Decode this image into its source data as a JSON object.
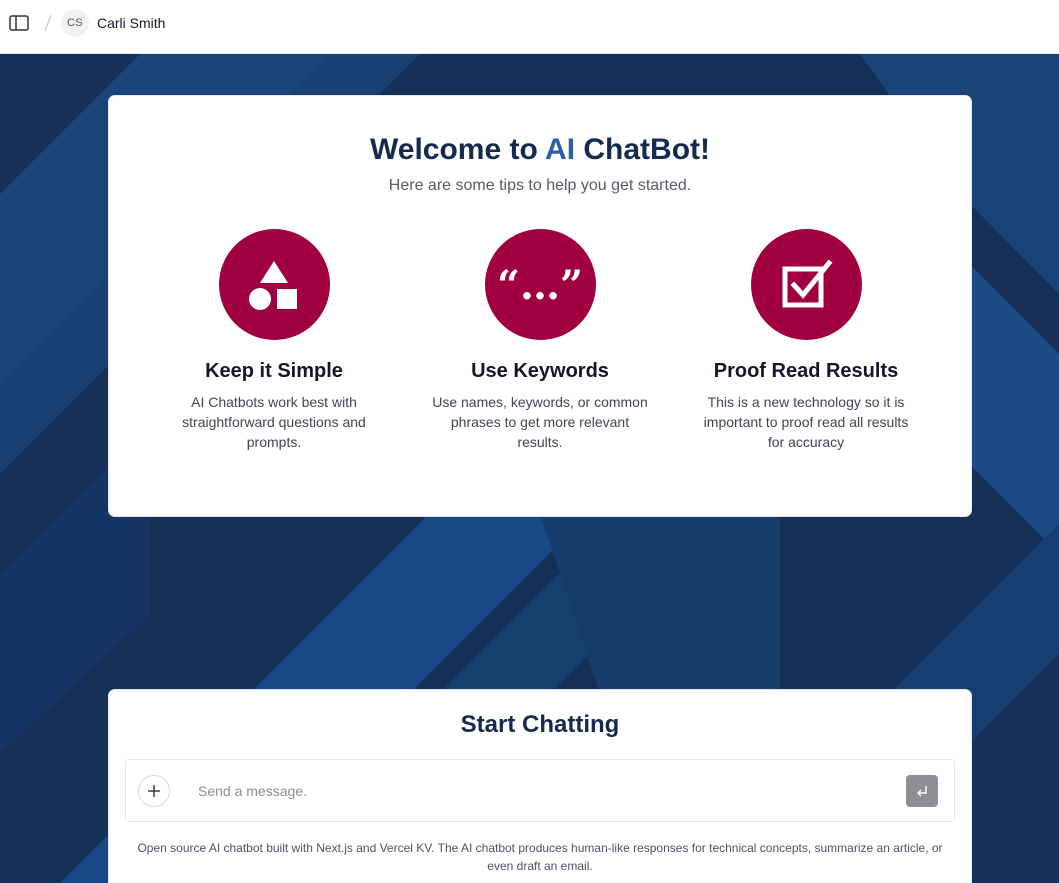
{
  "header": {
    "user_initials": "CS",
    "user_name": "Carli Smith"
  },
  "welcome": {
    "title_prefix": "Welcome to",
    "title_accent": "AI",
    "title_suffix": "ChatBot!",
    "subtitle": "Here are some tips to help you get started."
  },
  "tips": [
    {
      "icon": "shapes-icon",
      "title": "Keep it Simple",
      "description": "AI Chatbots work best with straightforward questions and prompts."
    },
    {
      "icon": "quote-icon",
      "title": "Use Keywords",
      "description": "Use names, keywords, or common phrases to get more relevant results."
    },
    {
      "icon": "checkbox-icon",
      "title": "Proof Read Results",
      "description": "This is a new technology so it is important to proof read all results for accuracy"
    }
  ],
  "chat": {
    "title": "Start Chatting",
    "input_placeholder": "Send a message.",
    "footer_note": "Open source AI chatbot built with Next.js and Vercel KV. The AI chatbot produces human-like responses for technical concepts, summarize an article, or even draft an email."
  },
  "colors": {
    "brand_navy": "#152a4e",
    "accent_blue": "#2d5fa3",
    "icon_crimson": "#a00040",
    "background_dark": "#143057"
  }
}
